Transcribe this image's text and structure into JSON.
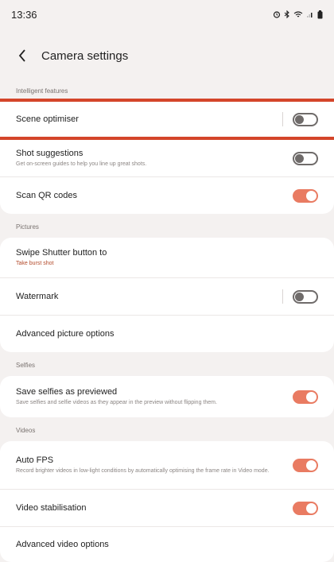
{
  "status_bar": {
    "time": "13:36"
  },
  "header": {
    "title": "Camera settings"
  },
  "sections": {
    "intelligent": {
      "label": "Intelligent features",
      "scene_optimiser": {
        "title": "Scene optimiser",
        "toggle": "off"
      },
      "shot_suggestions": {
        "title": "Shot suggestions",
        "subtitle": "Get on-screen guides to help you line up great shots.",
        "toggle": "off"
      },
      "scan_qr": {
        "title": "Scan QR codes",
        "toggle": "on"
      }
    },
    "pictures": {
      "label": "Pictures",
      "swipe_shutter": {
        "title": "Swipe Shutter button to",
        "subtitle": "Take burst shot"
      },
      "watermark": {
        "title": "Watermark",
        "toggle": "off"
      },
      "advanced_picture": {
        "title": "Advanced picture options"
      }
    },
    "selfies": {
      "label": "Selfies",
      "save_selfies": {
        "title": "Save selfies as previewed",
        "subtitle": "Save selfies and selfie videos as they appear in the preview without flipping them.",
        "toggle": "on"
      }
    },
    "videos": {
      "label": "Videos",
      "auto_fps": {
        "title": "Auto FPS",
        "subtitle": "Record brighter videos in low-light conditions by automatically optimising the frame rate in Video mode.",
        "toggle": "on"
      },
      "video_stabilisation": {
        "title": "Video stabilisation",
        "toggle": "on"
      },
      "advanced_video": {
        "title": "Advanced video options"
      }
    }
  },
  "colors": {
    "accent": "#e97b62",
    "highlight": "#d4452a",
    "background": "#f4f1f0"
  }
}
